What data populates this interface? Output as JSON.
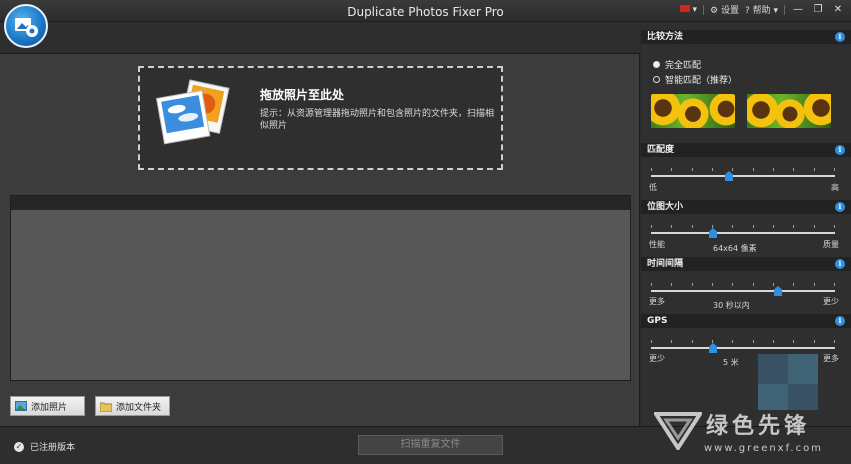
{
  "window": {
    "title": "Duplicate Photos Fixer Pro",
    "menu": {
      "settings": "设置",
      "help": "帮助"
    },
    "controls": {
      "minimize": "—",
      "restore": "❐",
      "close": "✕"
    }
  },
  "dropzone": {
    "title": "拖放照片至此处",
    "hint": "提示：从资源管理器拖动照片和包含照片的文件夹，扫描相似照片"
  },
  "buttons": {
    "add_photos": "添加照片",
    "add_folder": "添加文件夹",
    "scan": "扫描重复文件"
  },
  "status": {
    "registered": "已注册版本"
  },
  "panel": {
    "compare_method": {
      "title": "比较方法",
      "options": [
        "完全匹配",
        "智能匹配（推荐）"
      ],
      "selected": 0
    },
    "match_level": {
      "title": "匹配度",
      "min_label": "低",
      "max_label": "高",
      "value_fraction": 0.42
    },
    "bitmap_size": {
      "title": "位图大小",
      "min_label": "性能",
      "max_label": "质量",
      "value_label": "64x64 像素",
      "value_fraction": 0.33
    },
    "time_interval": {
      "title": "时间间隔",
      "min_label": "更多",
      "max_label": "更少",
      "value_label": "30 秒以内",
      "value_fraction": 0.7
    },
    "gps": {
      "title": "GPS",
      "min_label": "更少",
      "max_label": "更多",
      "value_label": "5 米",
      "value_fraction": 0.33
    }
  },
  "watermark": {
    "text": "绿色先锋",
    "url": "www.greenxf.com"
  },
  "colors": {
    "accent": "#2f8fe0",
    "panel_bg": "#2f2f2f",
    "main_bg": "#3c3c3c"
  }
}
